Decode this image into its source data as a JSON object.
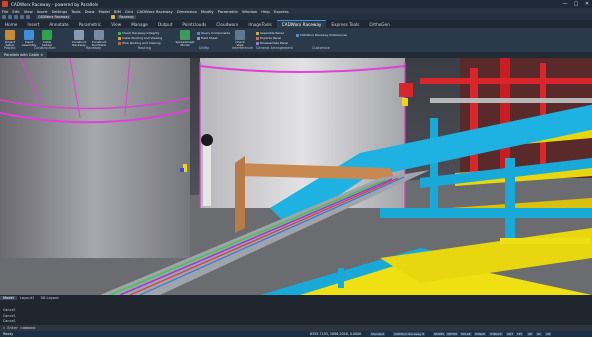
{
  "window": {
    "title": "CADWorx Raceway - powered by Parallels",
    "controls": [
      "—",
      "□",
      "✕"
    ]
  },
  "menu": [
    "File",
    "Edit",
    "View",
    "Insert",
    "Settings",
    "Tools",
    "Draw",
    "Model",
    "BIM",
    "Grid",
    "CADWorx Raceway",
    "Dimension",
    "Modify",
    "Parametric",
    "Window",
    "Help",
    "Express"
  ],
  "qat": {
    "workspace": "CADWorx Raceway",
    "layer": "Raceway"
  },
  "tabs": [
    "Home",
    "Insert",
    "Annotate",
    "Parametric",
    "View",
    "Manage",
    "Output",
    "Pointclouds",
    "Cloudworx",
    "ImageTools",
    "CADWorx Raceway",
    "Express Tools",
    "OrthoGen"
  ],
  "active_tab": "CADWorx Raceway",
  "ribbon": {
    "buttons": {
      "project": "Project Setup",
      "insert_assembly": "Insert Assembly",
      "cable_ladder": "Cable Ladder",
      "construct_raceway": "Construct Raceway",
      "construct_ductbank": "Construct Ductbank",
      "spreadsheet": "Spreadsheet Model",
      "check_view": "Check View"
    },
    "small": {
      "check_integrity": "Check Raceway Integrity",
      "cable_routing": "Cable Routing and Viewing",
      "wire_routing": "Wire Routing and Viewing",
      "query_components": "Query Components",
      "field_sheet": "Field Sheet",
      "assemble_panel": "Assemble Panel",
      "explode_panel": "Explode Panel",
      "disassemble_panel": "Disassemble Panel",
      "preferences": "CADWorx Raceway Preferences"
    },
    "panels": [
      "Project",
      "Construction",
      "Raceway",
      "Routing",
      "Utility",
      "Interference",
      "General Arrangement",
      "Customize"
    ]
  },
  "doc_tab": "Parallels with Cable ×",
  "layout_tabs": [
    "Model",
    "Layout1",
    "3D Layout"
  ],
  "command": {
    "history": [
      "Cancel",
      "Cancel",
      "Cancel"
    ],
    "prompt": "» Enter command"
  },
  "status": {
    "ready": "Ready",
    "coordinates": "6355.7193, 1896.2026, 0.0000",
    "items": [
      "Standard",
      "CADWorx Raceway 8",
      "MODEL",
      "ORTHO",
      "POLAR",
      "OSNAP",
      "OTRACK",
      "LWT",
      "TPY",
      "QP",
      "SC",
      "AM"
    ]
  }
}
